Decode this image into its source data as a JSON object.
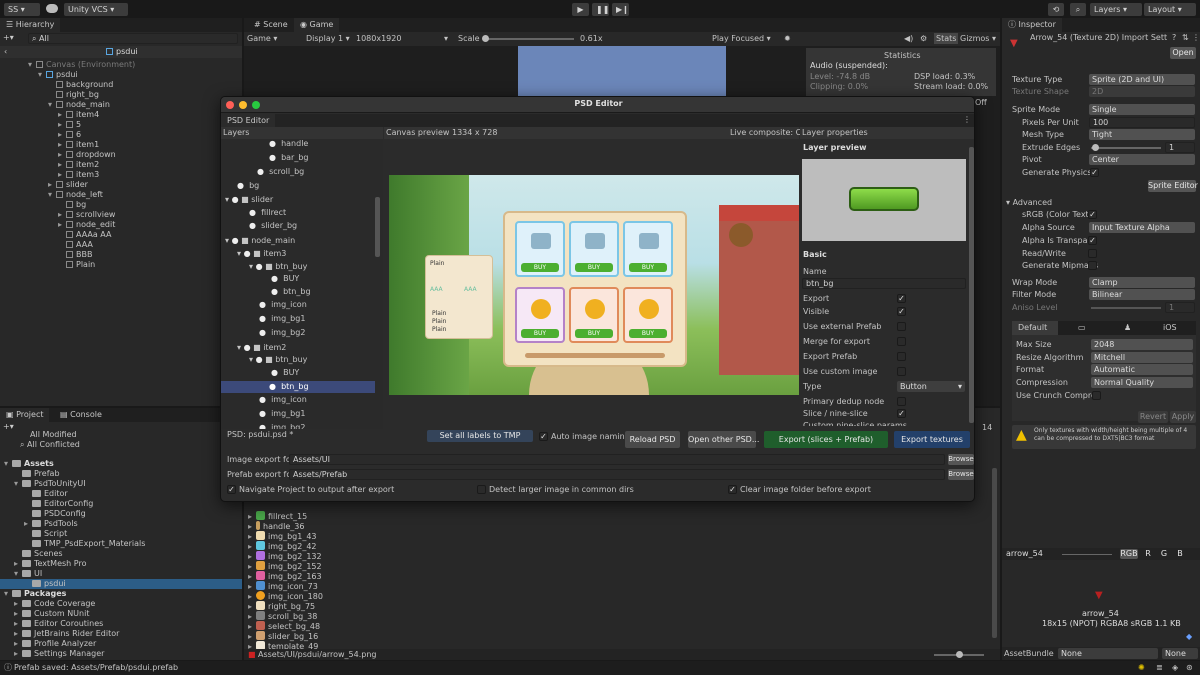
{
  "toolbar": {
    "account": "SS",
    "vcs": "Unity VCS",
    "layers": "Layers",
    "layout": "Layout"
  },
  "hierarchy": {
    "tab": "Hierarchy",
    "search": "All",
    "scene_root": "psdui",
    "items": [
      "Canvas (Environment)",
      "psdui",
      "background",
      "right_bg",
      "node_main",
      "item4",
      "5",
      "6",
      "item1",
      "dropdown",
      "item2",
      "item3",
      "slider",
      "node_left",
      "bg",
      "scrollview",
      "node_edit",
      "AAAa AA",
      "AAA",
      "BBB",
      "Plain"
    ]
  },
  "scene": {
    "tab_scene": "Scene",
    "tab_game": "Game",
    "display_mode": "Game",
    "display": "Display 1",
    "resolution": "1080x1920",
    "scale_label": "Scale",
    "scale_value": "0.61x",
    "play_focused": "Play Focused",
    "stats": "Stats",
    "gizmos": "Gizmos",
    "off": "Off"
  },
  "statistics": {
    "title": "Statistics",
    "audio": "Audio (suspended):",
    "level": "Level: -74.8 dB",
    "clipping": "Clipping: 0.0%",
    "dsp": "DSP load: 0.3%",
    "stream": "Stream load: 0.0%"
  },
  "project": {
    "tab_project": "Project",
    "tab_console": "Console",
    "items": [
      "All Modified",
      "All Conflicted",
      "Assets",
      "Prefab",
      "PsdToUnityUI",
      "Editor",
      "EditorConfig",
      "PSDConfig",
      "PsdTools",
      "Script",
      "TMP_PsdExport_Materials",
      "Scenes",
      "TextMesh Pro",
      "UI",
      "psdui",
      "Packages",
      "Code Coverage",
      "Custom NUnit",
      "Editor Coroutines",
      "JetBrains Rider Editor",
      "Profile Analyzer",
      "Settings Manager"
    ],
    "files": [
      "fillrect_15",
      "handle_36",
      "img_bg1_43",
      "img_bg2_42",
      "img_bg2_132",
      "img_bg2_152",
      "img_bg2_163",
      "img_icon_73",
      "img_icon_180",
      "right_bg_75",
      "scroll_bg_38",
      "select_bg_48",
      "slider_bg_16",
      "template_49"
    ],
    "path": "Assets/UI/psdui/arrow_54.png",
    "count": "14"
  },
  "status": {
    "message": "Prefab saved: Assets/Prefab/psdui.prefab"
  },
  "inspector": {
    "tab": "Inspector",
    "title": "Arrow_54 (Texture 2D) Import Sett",
    "open": "Open",
    "texture_type_label": "Texture Type",
    "texture_type": "Sprite (2D and UI)",
    "texture_shape_label": "Texture Shape",
    "texture_shape": "2D",
    "sprite_mode_label": "Sprite Mode",
    "sprite_mode": "Single",
    "ppu_label": "Pixels Per Unit",
    "ppu": "100",
    "mesh_type_label": "Mesh Type",
    "mesh_type": "Tight",
    "extrude_label": "Extrude Edges",
    "extrude": "1",
    "pivot_label": "Pivot",
    "pivot": "Center",
    "gen_physics_label": "Generate Physics S",
    "sprite_editor": "Sprite Editor",
    "advanced": "Advanced",
    "srgb_label": "sRGB (Color Textu",
    "alpha_source_label": "Alpha Source",
    "alpha_source": "Input Texture Alpha",
    "alpha_transp_label": "Alpha Is Transpare",
    "readwrite_label": "Read/Write",
    "mipmaps_label": "Generate Mipmaps",
    "wrap_label": "Wrap Mode",
    "wrap": "Clamp",
    "filter_label": "Filter Mode",
    "filter": "Bilinear",
    "aniso_label": "Aniso Level",
    "aniso": "1",
    "platform_default": "Default",
    "platform_ios": "iOS",
    "max_size_label": "Max Size",
    "max_size": "2048",
    "resize_label": "Resize Algorithm",
    "resize": "Mitchell",
    "format_label": "Format",
    "format": "Automatic",
    "compression_label": "Compression",
    "compression": "Normal Quality",
    "crunch_label": "Use Crunch Compres",
    "revert": "Revert",
    "apply": "Apply",
    "warning": "Only textures with width/height being multiple of 4 can be compressed to DXT5|BC3 format",
    "preview_name": "arrow_54",
    "rgb": "RGB",
    "r": "R",
    "g": "G",
    "b": "B",
    "preview_caption": "arrow_54",
    "preview_info": "18x15 (NPOT)  RGBA8 sRGB   1.1 KB",
    "assetbundle_label": "AssetBundle",
    "assetbundle": "None",
    "assetbundle_variant": "None"
  },
  "psd": {
    "title": "PSD Editor",
    "tab": "PSD Editor",
    "layers_header": "Layers",
    "canvas_label": "Canvas preview  1334 x 728",
    "live": "Live composite: On",
    "props_header": "Layer properties",
    "layer_preview": "Layer preview",
    "layers": [
      "handle",
      "bar_bg",
      "scroll_bg",
      "bg",
      "slider",
      "fillrect",
      "slider_bg",
      "node_main",
      "item3",
      "btn_buy",
      "BUY",
      "btn_bg",
      "img_icon",
      "img_bg1",
      "img_bg2",
      "item2",
      "btn_buy",
      "BUY",
      "btn_bg",
      "img_icon",
      "img_bg1",
      "img_bg2"
    ],
    "file": "PSD: psdui.psd *",
    "basic": "Basic",
    "name_label": "Name",
    "name": "btn_bg",
    "export_label": "Export",
    "visible_label": "Visible",
    "ext_prefab_label": "Use external Prefab",
    "merge_label": "Merge for export",
    "export_prefab_label": "Export Prefab",
    "custom_image_label": "Use custom image",
    "type_label": "Type",
    "type": "Button",
    "primary_dedup_label": "Primary dedup node",
    "slice_label": "Slice / nine-slice",
    "custom_slice_label": "Custom nine-slice params",
    "set_labels": "Set all labels to TMP",
    "auto_naming": "Auto image naming",
    "reload": "Reload PSD",
    "open_other": "Open other PSD...",
    "export_slices": "Export (slices + Prefab)",
    "export_textures": "Export textures",
    "image_folder_label": "Image export folde",
    "image_folder": "Assets/UI",
    "prefab_folder_label": "Prefab export fold",
    "prefab_folder": "Assets/Prefab",
    "browse": "Browse",
    "nav_label": "Navigate Project to output after export",
    "detect_label": "Detect larger image in common dirs",
    "clear_label": "Clear image folder before export",
    "canvas": {
      "plain": "Plain",
      "aaa": "AAA",
      "buy": "BUY"
    }
  }
}
